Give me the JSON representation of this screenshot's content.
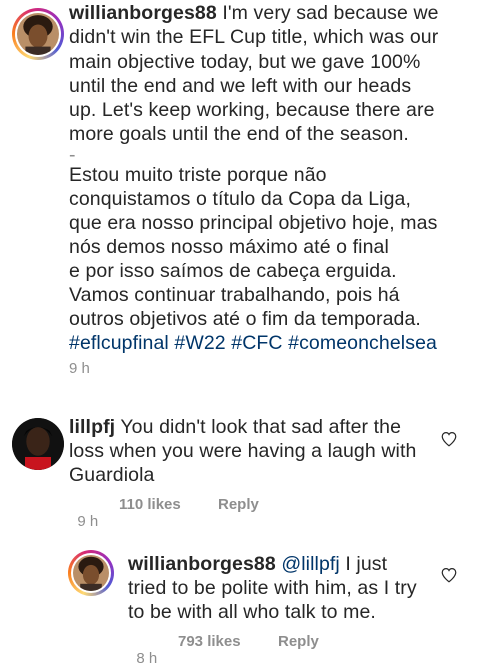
{
  "caption": {
    "username": "willianborges88",
    "lines": [
      " I'm very sad because we",
      "didn't win the EFL Cup title, which was our",
      "main objective today, but we gave 100%",
      "until the end and we left with our heads",
      "up. Let's keep working, because there are",
      "more goals until the end of the season.",
      "-",
      "Estou muito triste porque não",
      "conquistamos o título da Copa da Liga,",
      "que era nosso principal objetivo hoje, mas",
      "nós demos nosso máximo até o final",
      "e por isso saímos de cabeça erguida.",
      "Vamos continuar trabalhando, pois há",
      "outros objetivos até o fim da temporada."
    ],
    "hashtags": [
      "#eflcupfinal",
      "#W22",
      "#CFC",
      "#comeonchelsea"
    ],
    "time": "9 h"
  },
  "comment": {
    "username": "lillpfj",
    "lines": [
      " You didn't look that sad after the",
      "loss when you were having a laugh with",
      "Guardiola"
    ],
    "time": "9 h",
    "likes": "110 likes",
    "reply_label": "Reply",
    "like_icon": "heart-outline-icon"
  },
  "reply": {
    "username": "willianborges88",
    "mention": "@lillpfj",
    "lines": [
      " I just",
      "tried to be polite with him, as I try",
      "to be with all who talk to me."
    ],
    "time": "8 h",
    "likes": "793 likes",
    "reply_label": "Reply",
    "like_icon": "heart-outline-icon"
  },
  "colors": {
    "text": "#262626",
    "meta": "#8e8e8e",
    "hashtag": "#003569"
  }
}
